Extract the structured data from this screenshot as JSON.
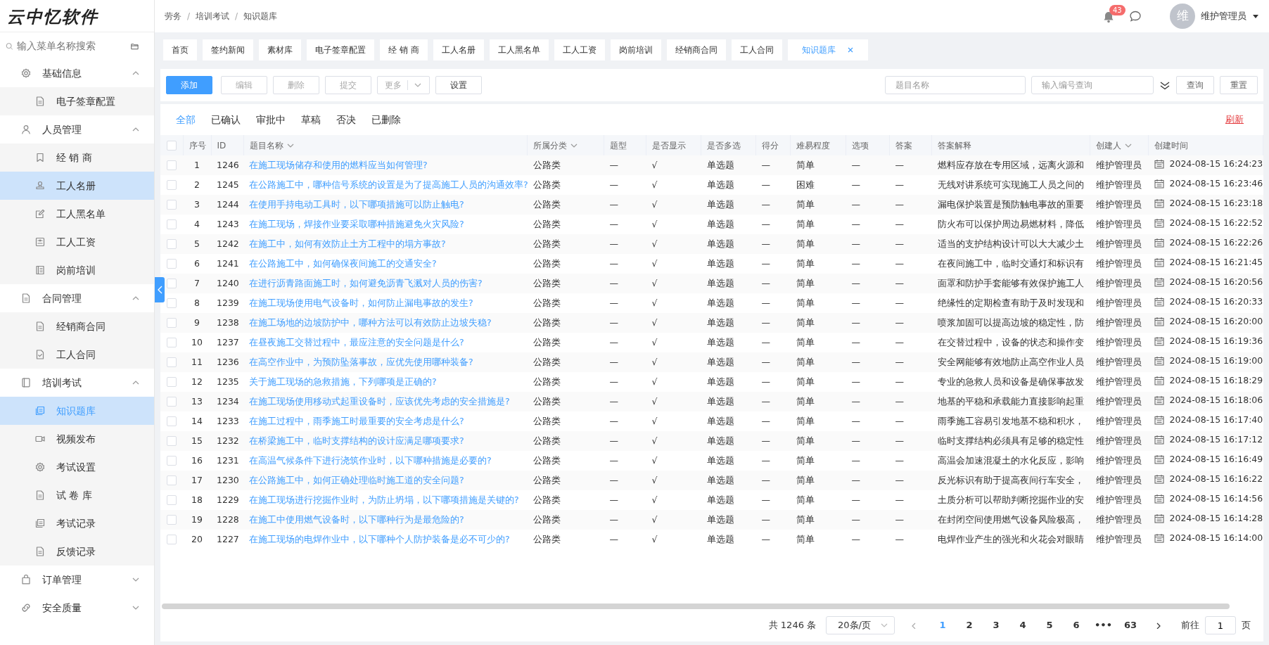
{
  "logo": "云中忆软件",
  "breadcrumb": [
    "劳务",
    "培训考试",
    "知识题库"
  ],
  "breadcrumb_separator": "/",
  "header": {
    "notification_count": "43",
    "avatar": "维",
    "user_name": "维护管理员"
  },
  "sidebar": {
    "search_placeholder": "输入菜单名称搜索",
    "items": [
      {
        "label": "基础信息",
        "expanded": true,
        "children": [
          {
            "label": "电子签章配置",
            "selected": false
          }
        ]
      },
      {
        "label": "人员管理",
        "expanded": true,
        "children": [
          {
            "label": "经 销 商",
            "selected": false
          },
          {
            "label": "工人名册",
            "selected": true
          },
          {
            "label": "工人黑名单",
            "selected": false
          },
          {
            "label": "工人工资",
            "selected": false
          },
          {
            "label": "岗前培训",
            "selected": false
          }
        ]
      },
      {
        "label": "合同管理",
        "expanded": true,
        "children": [
          {
            "label": "经销商合同",
            "selected": false
          },
          {
            "label": "工人合同",
            "selected": false
          }
        ]
      },
      {
        "label": "培训考试",
        "expanded": true,
        "children": [
          {
            "label": "知识题库",
            "selected": true
          },
          {
            "label": "视频发布",
            "selected": false
          },
          {
            "label": "考试设置",
            "selected": false
          },
          {
            "label": "试 卷 库",
            "selected": false
          },
          {
            "label": "考试记录",
            "selected": false
          },
          {
            "label": "反馈记录",
            "selected": false
          }
        ]
      },
      {
        "label": "订单管理",
        "expanded": false
      },
      {
        "label": "安全质量",
        "expanded": false
      }
    ]
  },
  "open_tabs": [
    {
      "label": "首页",
      "selected": false
    },
    {
      "label": "签约新闻",
      "selected": false
    },
    {
      "label": "素材库",
      "selected": false
    },
    {
      "label": "电子签章配置",
      "selected": false
    },
    {
      "label": "经 销 商",
      "selected": false
    },
    {
      "label": "工人名册",
      "selected": false
    },
    {
      "label": "工人黑名单",
      "selected": false
    },
    {
      "label": "工人工资",
      "selected": false
    },
    {
      "label": "岗前培训",
      "selected": false
    },
    {
      "label": "经销商合同",
      "selected": false
    },
    {
      "label": "工人合同",
      "selected": false
    },
    {
      "label": "知识题库",
      "selected": true
    }
  ],
  "toolbar": {
    "buttons": [
      {
        "label": "添加",
        "kind": "primary",
        "disabled": false
      },
      {
        "label": "编辑",
        "kind": "plain",
        "disabled": true
      },
      {
        "label": "删除",
        "kind": "plain",
        "disabled": true
      },
      {
        "label": "提交",
        "kind": "plain",
        "disabled": true
      },
      {
        "label": "更多",
        "kind": "dropdown",
        "disabled": true
      },
      {
        "label": "设置",
        "kind": "plain",
        "disabled": false
      }
    ],
    "search_fields": [
      {
        "placeholder": "题目名称"
      },
      {
        "placeholder": "输入编号查询"
      }
    ],
    "actions": [
      "查询",
      "重置"
    ]
  },
  "status_tabs": [
    {
      "label": "全部",
      "selected": true
    },
    {
      "label": "已确认",
      "selected": false
    },
    {
      "label": "审批中",
      "selected": false
    },
    {
      "label": "草稿",
      "selected": false
    },
    {
      "label": "否决",
      "selected": false
    },
    {
      "label": "已删除",
      "selected": false
    }
  ],
  "refresh": "刷新",
  "table": {
    "all_checked": false,
    "columns": [
      {
        "label": "序号",
        "sortable": false
      },
      {
        "label": "ID",
        "sortable": false
      },
      {
        "label": "题目名称",
        "sortable": true
      },
      {
        "label": "所属分类",
        "sortable": true
      },
      {
        "label": "题型",
        "sortable": false
      },
      {
        "label": "是否显示",
        "sortable": false
      },
      {
        "label": "是否多选",
        "sortable": false
      },
      {
        "label": "得分",
        "sortable": false
      },
      {
        "label": "难易程度",
        "sortable": false
      },
      {
        "label": "选项",
        "sortable": false
      },
      {
        "label": "答案",
        "sortable": false
      },
      {
        "label": "答案解释",
        "sortable": false
      },
      {
        "label": "创建人",
        "sortable": true
      },
      {
        "label": "创建时间",
        "sortable": false
      }
    ],
    "rows": [
      {
        "checked": false,
        "cells": [
          "1",
          "1246",
          "在施工现场储存和使用的燃料应当如何管理?",
          "公路类",
          "—",
          "√",
          "单选题",
          "—",
          "简单",
          "—",
          "—",
          "燃料应存放在专用区域，远离火源和",
          "维护管理员",
          "2024-08-15 16:24:23"
        ]
      },
      {
        "checked": false,
        "cells": [
          "2",
          "1245",
          "在公路施工中，哪种信号系统的设置是为了提高施工人员的沟通效率?",
          "公路类",
          "—",
          "√",
          "单选题",
          "—",
          "困难",
          "—",
          "—",
          "无线对讲系统可实现施工人员之间的",
          "维护管理员",
          "2024-08-15 16:23:46"
        ]
      },
      {
        "checked": false,
        "cells": [
          "3",
          "1244",
          "在使用手持电动工具时，以下哪项措施可以防止触电?",
          "公路类",
          "—",
          "√",
          "单选题",
          "—",
          "简单",
          "—",
          "—",
          "漏电保护装置是预防触电事故的重要",
          "维护管理员",
          "2024-08-15 16:23:18"
        ]
      },
      {
        "checked": false,
        "cells": [
          "4",
          "1243",
          "在施工现场，焊接作业要采取哪种措施避免火灾风险?",
          "公路类",
          "—",
          "√",
          "单选题",
          "—",
          "简单",
          "—",
          "—",
          "防火布可以保护周边易燃材料，降低",
          "维护管理员",
          "2024-08-15 16:22:52"
        ]
      },
      {
        "checked": false,
        "cells": [
          "5",
          "1242",
          "在施工中，如何有效防止土方工程中的塌方事故?",
          "公路类",
          "—",
          "√",
          "单选题",
          "—",
          "简单",
          "—",
          "—",
          "适当的支护结构设计可以大大减少土",
          "维护管理员",
          "2024-08-15 16:22:26"
        ]
      },
      {
        "checked": false,
        "cells": [
          "6",
          "1241",
          "在公路施工中，如何确保夜间施工的交通安全?",
          "公路类",
          "—",
          "√",
          "单选题",
          "—",
          "简单",
          "—",
          "—",
          "在夜间施工中，临时交通灯和标识有",
          "维护管理员",
          "2024-08-15 16:21:45"
        ]
      },
      {
        "checked": false,
        "cells": [
          "7",
          "1240",
          "在进行沥青路面施工时，如何避免沥青飞溅对人员的伤害?",
          "公路类",
          "—",
          "√",
          "单选题",
          "—",
          "简单",
          "—",
          "—",
          "面罩和防护手套能够有效保护施工人",
          "维护管理员",
          "2024-08-15 16:20:56"
        ]
      },
      {
        "checked": false,
        "cells": [
          "8",
          "1239",
          "在施工现场使用电气设备时，如何防止漏电事故的发生?",
          "公路类",
          "—",
          "√",
          "单选题",
          "—",
          "简单",
          "—",
          "—",
          "绝缘性的定期检查有助于及时发现和",
          "维护管理员",
          "2024-08-15 16:20:33"
        ]
      },
      {
        "checked": false,
        "cells": [
          "9",
          "1238",
          "在施工场地的边坡防护中，哪种方法可以有效防止边坡失稳?",
          "公路类",
          "—",
          "√",
          "单选题",
          "—",
          "简单",
          "—",
          "—",
          "喷浆加固可以提高边坡的稳定性，防",
          "维护管理员",
          "2024-08-15 16:20:00"
        ]
      },
      {
        "checked": false,
        "cells": [
          "10",
          "1237",
          "在昼夜施工交替过程中，最应注意的安全问题是什么?",
          "公路类",
          "—",
          "√",
          "单选题",
          "—",
          "简单",
          "—",
          "—",
          "在交替过程中，设备的状态和操作变",
          "维护管理员",
          "2024-08-15 16:19:36"
        ]
      },
      {
        "checked": false,
        "cells": [
          "11",
          "1236",
          "在高空作业中，为预防坠落事故，应优先使用哪种装备?",
          "公路类",
          "—",
          "√",
          "单选题",
          "—",
          "简单",
          "—",
          "—",
          "安全网能够有效地防止高空作业人员",
          "维护管理员",
          "2024-08-15 16:19:00"
        ]
      },
      {
        "checked": false,
        "cells": [
          "12",
          "1235",
          "关于施工现场的急救措施，下列哪项是正确的?",
          "公路类",
          "—",
          "√",
          "单选题",
          "—",
          "简单",
          "—",
          "—",
          "专业的急救人员和设备是确保事故发",
          "维护管理员",
          "2024-08-15 16:18:29"
        ]
      },
      {
        "checked": false,
        "cells": [
          "13",
          "1234",
          "在施工现场使用移动式起重设备时，应该优先考虑的安全措施是?",
          "公路类",
          "—",
          "√",
          "单选题",
          "—",
          "简单",
          "—",
          "—",
          "地基的平稳和承载能力直接影响起重",
          "维护管理员",
          "2024-08-15 16:18:06"
        ]
      },
      {
        "checked": false,
        "cells": [
          "14",
          "1233",
          "在施工过程中，雨季施工时最重要的安全考虑是什么?",
          "公路类",
          "—",
          "√",
          "单选题",
          "—",
          "简单",
          "—",
          "—",
          "雨季施工容易引发地基不稳和积水，",
          "维护管理员",
          "2024-08-15 16:17:40"
        ]
      },
      {
        "checked": false,
        "cells": [
          "15",
          "1232",
          "在桥梁施工中，临时支撑结构的设计应满足哪项要求?",
          "公路类",
          "—",
          "√",
          "单选题",
          "—",
          "简单",
          "—",
          "—",
          "临时支撑结构必须具有足够的稳定性",
          "维护管理员",
          "2024-08-15 16:17:12"
        ]
      },
      {
        "checked": false,
        "cells": [
          "16",
          "1231",
          "在高温气候条件下进行浇筑作业时，以下哪种措施是必要的?",
          "公路类",
          "—",
          "√",
          "单选题",
          "—",
          "简单",
          "—",
          "—",
          "高温会加速混凝土的水化反应，影响",
          "维护管理员",
          "2024-08-15 16:16:49"
        ]
      },
      {
        "checked": false,
        "cells": [
          "17",
          "1230",
          "在公路施工中，如何正确处理临时施工道的安全问题?",
          "公路类",
          "—",
          "√",
          "单选题",
          "—",
          "简单",
          "—",
          "—",
          "反光标识有助于提高夜间行车安全，",
          "维护管理员",
          "2024-08-15 16:16:22"
        ]
      },
      {
        "checked": false,
        "cells": [
          "18",
          "1229",
          "在施工现场进行挖掘作业时，为防止坍塌，以下哪项措施是关键的?",
          "公路类",
          "—",
          "√",
          "单选题",
          "—",
          "简单",
          "—",
          "—",
          "土质分析可以帮助判断挖掘作业的安",
          "维护管理员",
          "2024-08-15 16:14:56"
        ]
      },
      {
        "checked": false,
        "cells": [
          "19",
          "1228",
          "在施工中使用燃气设备时，以下哪种行为是最危险的?",
          "公路类",
          "—",
          "√",
          "单选题",
          "—",
          "简单",
          "—",
          "—",
          "在封闭空间使用燃气设备风险极高，",
          "维护管理员",
          "2024-08-15 16:14:28"
        ]
      },
      {
        "checked": false,
        "cells": [
          "20",
          "1227",
          "在施工现场的电焊作业中，以下哪种个人防护装备是必不可少的?",
          "公路类",
          "—",
          "√",
          "单选题",
          "—",
          "简单",
          "—",
          "—",
          "电焊作业产生的强光和火花会对眼睛",
          "维护管理员",
          "2024-08-15 16:14:00"
        ]
      }
    ]
  },
  "pagination": {
    "total": "共 1246 条",
    "page_size": "20条/页",
    "pages": [
      {
        "label": "1",
        "selected": true
      },
      {
        "label": "2",
        "selected": false
      },
      {
        "label": "3",
        "selected": false
      },
      {
        "label": "4",
        "selected": false
      },
      {
        "label": "5",
        "selected": false
      },
      {
        "label": "6",
        "selected": false
      },
      {
        "label": "•••",
        "selected": false
      },
      {
        "label": "63",
        "selected": false
      }
    ],
    "goto_label": "前往",
    "goto_value": "1",
    "goto_unit": "页"
  }
}
